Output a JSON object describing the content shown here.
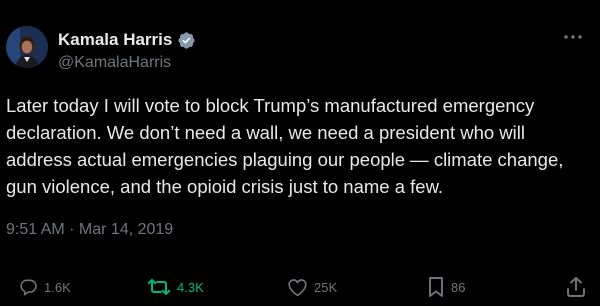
{
  "author": {
    "name": "Kamala Harris",
    "handle": "@KamalaHarris",
    "verified": true
  },
  "tweet": {
    "text": "Later today I will vote to block Trump’s manufactured emergency declaration. We don’t need a wall, we need a president who will address actual emergencies plaguing our people — climate change, gun violence, and the opioid crisis just to name a few.",
    "timestamp": "9:51 AM · Mar 14, 2019"
  },
  "actions": {
    "replies": "1.6K",
    "retweets": "4.3K",
    "likes": "25K",
    "bookmarks": "86"
  },
  "icons": {
    "reply": "speech-bubble-icon",
    "retweet": "retweet-arrows-icon",
    "like": "heart-icon",
    "bookmark": "bookmark-icon",
    "share": "share-upload-icon",
    "more": "more-dots-icon",
    "verified": "verified-badge-icon"
  },
  "colors": {
    "background": "#000000",
    "text": "#e7e9ea",
    "secondary": "#71767b",
    "verified_badge": "#829aab",
    "retweet_active": "#00ba7c"
  }
}
